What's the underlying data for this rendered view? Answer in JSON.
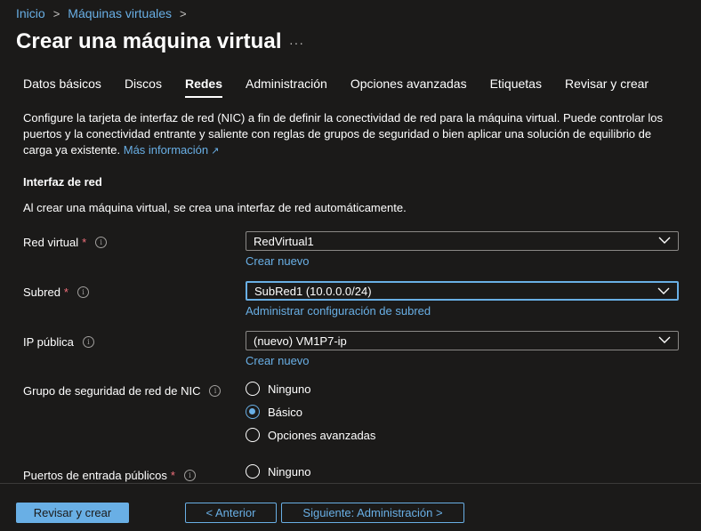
{
  "breadcrumb": {
    "home": "Inicio",
    "parent": "Máquinas virtuales",
    "sep": ">"
  },
  "page": {
    "title": "Crear una máquina virtual",
    "more": "···"
  },
  "tabs": [
    {
      "label": "Datos básicos"
    },
    {
      "label": "Discos"
    },
    {
      "label": "Redes",
      "active": true
    },
    {
      "label": "Administración"
    },
    {
      "label": "Opciones avanzadas"
    },
    {
      "label": "Etiquetas"
    },
    {
      "label": "Revisar y crear"
    }
  ],
  "description": {
    "text": "Configure la tarjeta de interfaz de red (NIC) a fin de definir la conectividad de red para la máquina virtual. Puede controlar los puertos y la conectividad entrante y saliente con reglas de grupos de seguridad o bien aplicar una solución de equilibrio de carga ya existente.",
    "link": "Más información"
  },
  "network_interface": {
    "title": "Interfaz de red",
    "desc": "Al crear una máquina virtual, se crea una interfaz de red automáticamente."
  },
  "fields": {
    "vnet": {
      "label": "Red virtual",
      "required": "*",
      "value": "RedVirtual1",
      "link": "Crear nuevo"
    },
    "subnet": {
      "label": "Subred",
      "required": "*",
      "value": "SubRed1 (10.0.0.0/24)",
      "link": "Administrar configuración de subred"
    },
    "public_ip": {
      "label": "IP pública",
      "value": "(nuevo) VM1P7-ip",
      "link": "Crear nuevo"
    },
    "nsg": {
      "label": "Grupo de seguridad de red de NIC",
      "options": [
        "Ninguno",
        "Básico",
        "Opciones avanzadas"
      ],
      "selected": "Básico"
    },
    "inbound_ports": {
      "label": "Puertos de entrada públicos",
      "required": "*",
      "options": [
        "Ninguno"
      ]
    }
  },
  "footer": {
    "review": "Revisar y crear",
    "prev": "< Anterior",
    "next": "Siguiente: Administración >"
  },
  "colors": {
    "background": "#1b1a19",
    "accent": "#69afe5",
    "required": "#f1707b"
  }
}
